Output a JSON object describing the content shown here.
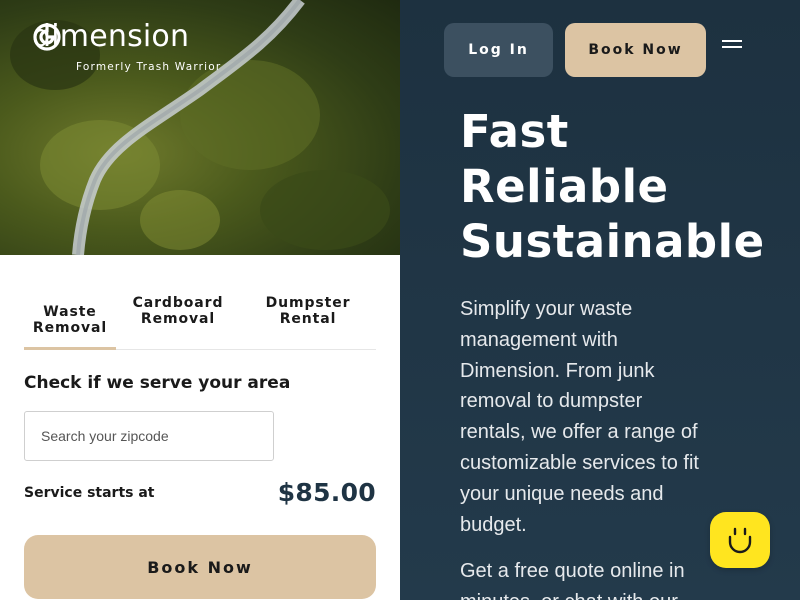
{
  "brand": {
    "name": "dimension",
    "tagline": "Formerly Trash Warrior"
  },
  "tabs": [
    {
      "label": "Waste Removal",
      "active": true
    },
    {
      "label": "Cardboard Removal",
      "active": false
    },
    {
      "label": "Dumpster Rental",
      "active": false
    }
  ],
  "service_check": {
    "title": "Check if we serve your area",
    "zip_placeholder": "Search your zipcode",
    "zip_value": "",
    "starts_label": "Service starts at",
    "price": "$85.00",
    "book_label": "Book Now"
  },
  "nav": {
    "login_label": "Log In",
    "book_label": "Book Now",
    "menu_icon": "hamburger-menu-icon"
  },
  "hero": {
    "headline": [
      "Fast",
      "Reliable",
      "Sustainable"
    ],
    "description": "Simplify your waste management with Dimension. From junk removal to dumpster rentals, we offer a range of customizable services to fit your unique needs and budget.",
    "description2": "Get a free quote online in minutes, or chat with our"
  },
  "chat": {
    "icon": "smiley-chat-icon"
  },
  "colors": {
    "navy": "#1f3444",
    "tan": "#dcc4a3",
    "login_bg": "#3c5060",
    "chat_yellow": "#ffe51f"
  }
}
